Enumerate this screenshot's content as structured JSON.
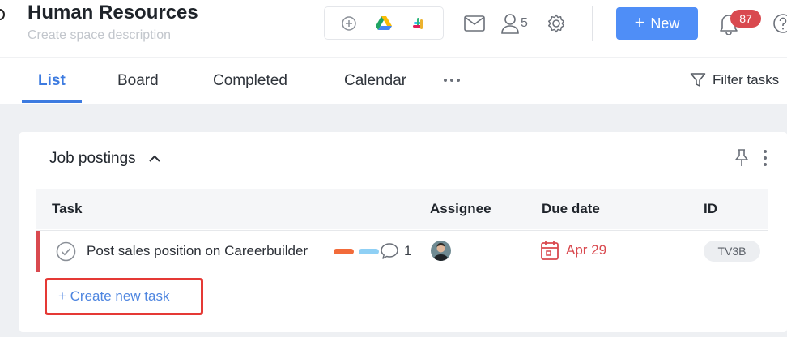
{
  "space": {
    "title": "Human Resources",
    "description_placeholder": "Create space description"
  },
  "header": {
    "integrations": [
      "add-integration-icon",
      "google-drive-icon",
      "slack-icon"
    ],
    "member_count": "5",
    "new_button_label": "New",
    "notification_count": "87"
  },
  "tabs": [
    {
      "label": "List",
      "active": true
    },
    {
      "label": "Board"
    },
    {
      "label": "Completed"
    },
    {
      "label": "Calendar"
    }
  ],
  "filter_label": "Filter tasks",
  "section": {
    "title": "Job postings",
    "columns": {
      "task": "Task",
      "assignee": "Assignee",
      "due_date": "Due date",
      "id": "ID"
    },
    "tasks": [
      {
        "name": "Post sales position on Careerbuilder",
        "tags": [
          "#f26b3a",
          "#8fd0f5"
        ],
        "comment_count": "1",
        "due_date": "Apr 29",
        "id": "TV3B"
      }
    ],
    "create_label": "+ Create new task"
  },
  "colors": {
    "accent": "#4f8ef7",
    "overdue": "#d9494f",
    "highlight_box": "#e53935"
  }
}
